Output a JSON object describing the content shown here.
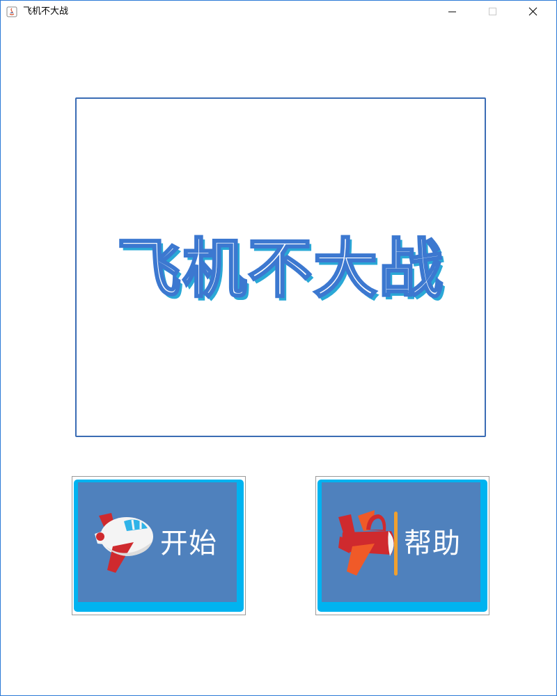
{
  "window": {
    "title": "飞机不大战"
  },
  "main": {
    "game_title": "飞机不大战"
  },
  "buttons": {
    "start_label": "开始",
    "help_label": "帮助"
  },
  "colors": {
    "title_stroke": "#3c78d0",
    "title_shadow": "#2aa8d6",
    "button_face": "#4f81bd",
    "button_border": "#00b3f0",
    "panel_border": "#3a6cb4"
  },
  "icons": {
    "app": "java-icon",
    "start_button": "white-plane-icon",
    "help_button": "red-propeller-plane-icon"
  }
}
